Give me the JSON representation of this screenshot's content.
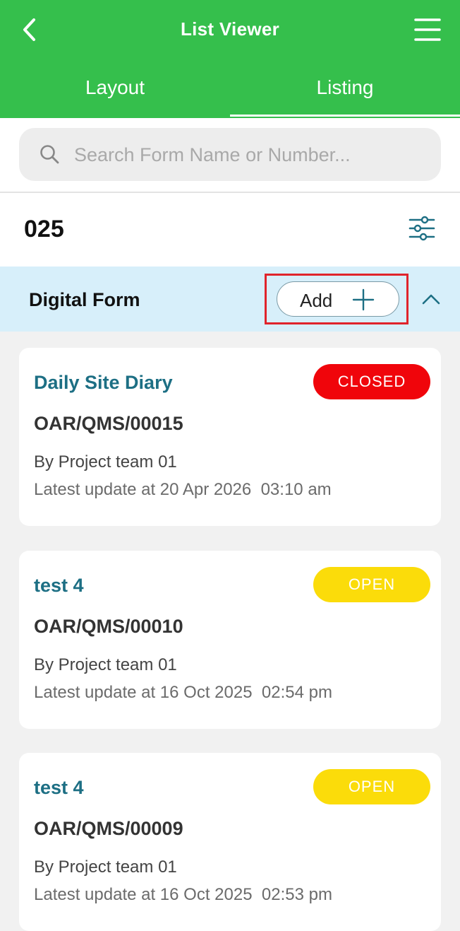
{
  "header": {
    "title": "List Viewer",
    "tabs": [
      {
        "label": "Layout",
        "active": true
      },
      {
        "label": "Listing",
        "active": false
      }
    ],
    "back_icon": "chevron-left-icon",
    "menu_icon": "hamburger-menu-icon",
    "color": "#35bf4c"
  },
  "search": {
    "placeholder": "Search Form Name or Number...",
    "value": "",
    "icon": "search-icon"
  },
  "project": {
    "code": "025",
    "filter_icon": "sliders-icon"
  },
  "section": {
    "title": "Digital Form",
    "add_label": "Add",
    "add_icon": "plus-icon",
    "collapse_icon": "chevron-up-icon"
  },
  "cards": [
    {
      "title": "Daily Site Diary",
      "status": "CLOSED",
      "status_color": "#f0050b",
      "number": "OAR/QMS/00015",
      "by": "By Project team 01",
      "updated": "Latest update at 20 Apr 2026  03:10 am"
    },
    {
      "title": "test 4",
      "status": "OPEN",
      "status_color": "#fbdc0a",
      "number": "OAR/QMS/00010",
      "by": "By Project team 01",
      "updated": "Latest update at 16 Oct 2025  02:54 pm"
    },
    {
      "title": "test 4",
      "status": "OPEN",
      "status_color": "#fbdc0a",
      "number": "OAR/QMS/00009",
      "by": "By Project team 01",
      "updated": "Latest update at 16 Oct 2025  02:53 pm"
    }
  ]
}
